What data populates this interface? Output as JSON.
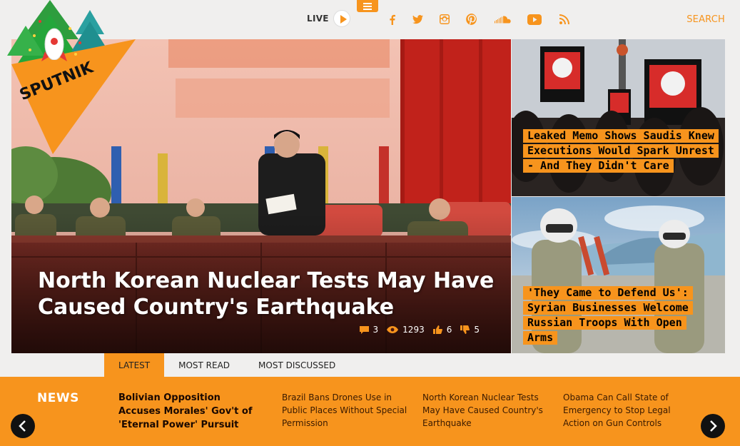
{
  "colors": {
    "accent": "#f7941d",
    "background": "#f0efee",
    "text": "#222222"
  },
  "header": {
    "live_label": "LIVE",
    "search_label": "SEARCH",
    "social_icons": [
      "facebook-icon",
      "twitter-icon",
      "instagram-icon",
      "pinterest-icon",
      "soundcloud-icon",
      "youtube-icon",
      "rss-icon"
    ]
  },
  "logo": {
    "text": "SPUTNIK"
  },
  "hero": {
    "title": "North Korean Nuclear Tests May Have Caused Country's Earthquake",
    "comments": "3",
    "views": "1293",
    "likes": "6",
    "dislikes": "5"
  },
  "side_stories": [
    {
      "title": "Leaked Memo Shows Saudis Knew Executions Would Spark Unrest - And They Didn't Care"
    },
    {
      "title": "'They Came to Defend Us': Syrian Businesses Welcome Russian Troops With Open Arms"
    }
  ],
  "tabs": [
    {
      "label": "LATEST",
      "active": true
    },
    {
      "label": "MOST READ",
      "active": false
    },
    {
      "label": "MOST DISCUSSED",
      "active": false
    }
  ],
  "news": {
    "label": "NEWS",
    "items": [
      {
        "title": "Bolivian Opposition Accuses Morales' Gov't of 'Eternal Power' Pursuit"
      },
      {
        "title": "Brazil Bans Drones Use in Public Places Without Special Permission"
      },
      {
        "title": "North Korean Nuclear Tests May Have Caused Country's Earthquake"
      },
      {
        "title": "Obama Can Call State of Emergency to Stop Legal Action on Gun Controls"
      }
    ]
  }
}
